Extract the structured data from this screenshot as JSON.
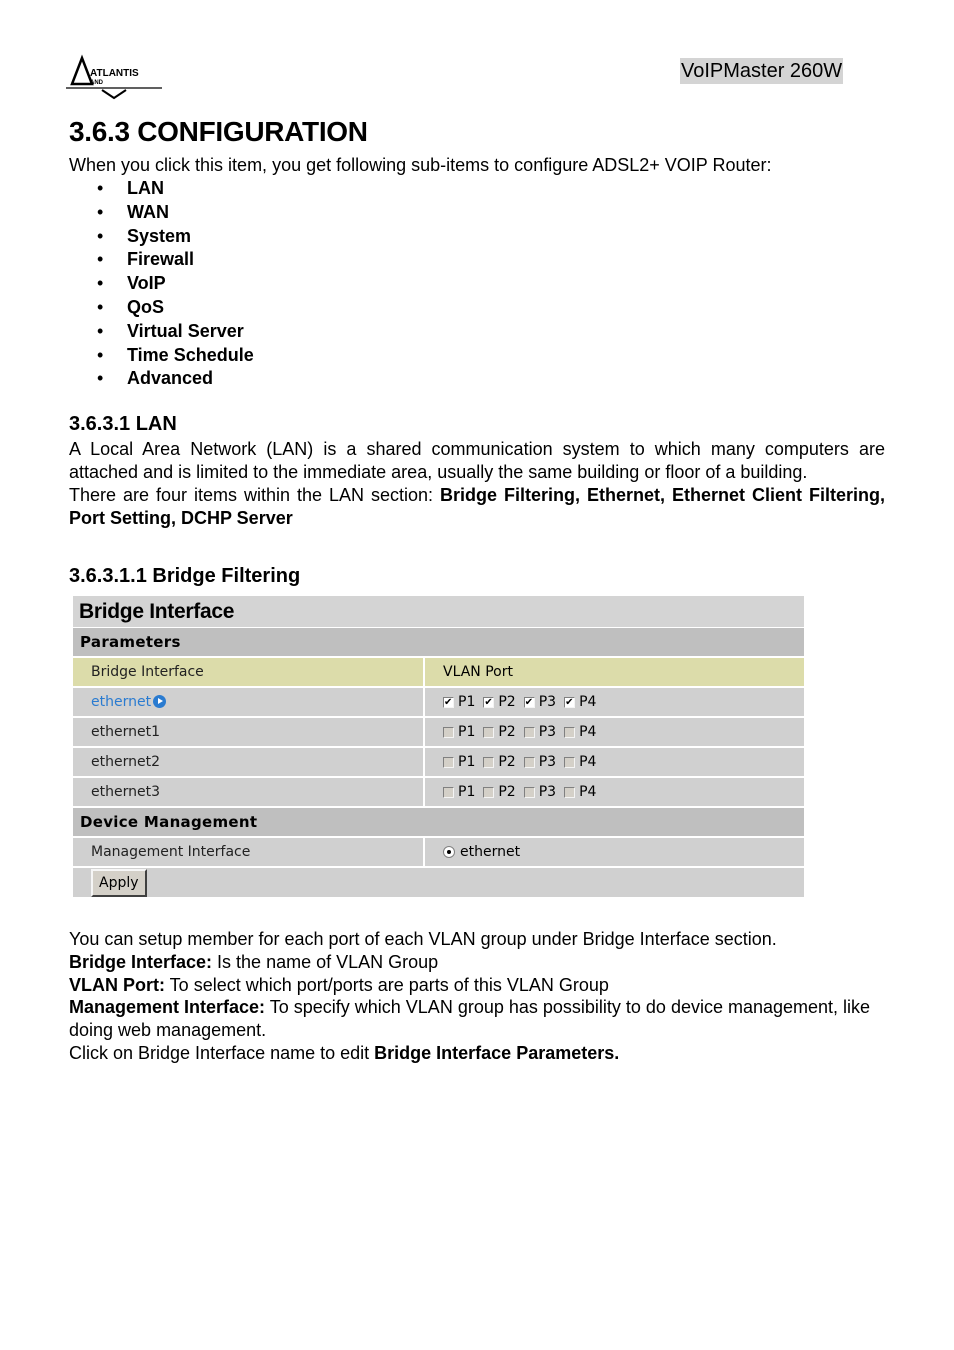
{
  "header": {
    "logo_text": "ATLANTIS",
    "logo_subtext": "AND",
    "model": "VoIPMaster 260W"
  },
  "section": {
    "title": "3.6.3 CONFIGURATION",
    "intro": "When you click this item, you get following sub-items to configure ADSL2+ VOIP Router:",
    "items": [
      "LAN",
      "WAN",
      "System",
      "Firewall",
      "VoIP",
      "QoS",
      "Virtual Server",
      "Time Schedule",
      "Advanced"
    ]
  },
  "lan": {
    "title": "3.6.3.1 LAN",
    "para1": "A Local Area Network (LAN) is a shared communication system to which many computers are attached and is limited to the immediate area, usually the same building or floor of a building.",
    "para2_prefix": "There are four items within the LAN section: ",
    "para2_bold": "Bridge Filtering, Ethernet, Ethernet Client Filtering, Port Setting, DCHP Server"
  },
  "bridge_filtering": {
    "title": "3.6.3.1.1 Bridge Filtering"
  },
  "bridge_ui": {
    "title": "Bridge Interface",
    "parameters_label": "Parameters",
    "col_interface": "Bridge Interface",
    "col_vlan_port": "VLAN Port",
    "rows": [
      {
        "name": "ethernet",
        "link": true,
        "ports": [
          {
            "label": "P1",
            "checked": true
          },
          {
            "label": "P2",
            "checked": true
          },
          {
            "label": "P3",
            "checked": true
          },
          {
            "label": "P4",
            "checked": true
          }
        ]
      },
      {
        "name": "ethernet1",
        "link": false,
        "ports": [
          {
            "label": "P1",
            "checked": false
          },
          {
            "label": "P2",
            "checked": false
          },
          {
            "label": "P3",
            "checked": false
          },
          {
            "label": "P4",
            "checked": false
          }
        ]
      },
      {
        "name": "ethernet2",
        "link": false,
        "ports": [
          {
            "label": "P1",
            "checked": false
          },
          {
            "label": "P2",
            "checked": false
          },
          {
            "label": "P3",
            "checked": false
          },
          {
            "label": "P4",
            "checked": false
          }
        ]
      },
      {
        "name": "ethernet3",
        "link": false,
        "ports": [
          {
            "label": "P1",
            "checked": false
          },
          {
            "label": "P2",
            "checked": false
          },
          {
            "label": "P3",
            "checked": false
          },
          {
            "label": "P4",
            "checked": false
          }
        ]
      }
    ],
    "device_management_label": "Device Management",
    "management_interface_label": "Management Interface",
    "management_interface_value": "ethernet",
    "apply_label": "Apply"
  },
  "description": {
    "line1": "You can setup member for each port of each VLAN group under Bridge Interface section.",
    "bi_label": "Bridge Interface:",
    "bi_text": " Is the name of VLAN Group",
    "vp_label": "VLAN Port:",
    "vp_text": " To select which port/ports are parts of this VLAN Group",
    "mi_label": "Management Interface:",
    "mi_text": " To specify which VLAN group has possibility to do device management, like doing web management.",
    "click_prefix": "Click on Bridge Interface name to edit ",
    "click_bold": "Bridge Interface Parameters."
  }
}
